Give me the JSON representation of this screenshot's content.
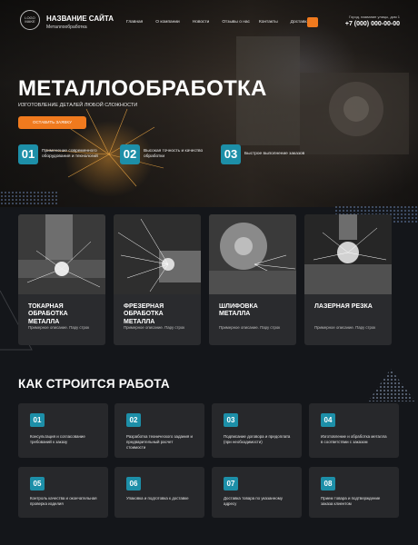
{
  "header": {
    "logo_text": "LOGO\nMAKE",
    "site_name": "НАЗВАНИЕ САЙТА",
    "site_tagline": "Металлообработка",
    "nav": [
      "Главная",
      "О компании",
      "Новости",
      "Отзывы о нас",
      "Контакты",
      "Доставка"
    ],
    "address": "Город, название улицы, дом 1",
    "phone": "+7 (000) 000-00-00"
  },
  "hero": {
    "title": "МЕТАЛЛООБРАБОТКА",
    "subtitle": "ИЗГОТОВЛЕНИЕ ДЕТАЛЕЙ ЛЮБОЙ СЛОЖНОСТИ",
    "cta_label": "ОСТАВИТЬ ЗАЯВКУ",
    "features": [
      {
        "num": "01",
        "text": "Применение современного\nоборудования и технологий"
      },
      {
        "num": "02",
        "text": "Высокая точность и качество\nобработки"
      },
      {
        "num": "03",
        "text": "Быстрое выполнение заказов"
      }
    ]
  },
  "services": [
    {
      "title": "ТОКАРНАЯ\nОБРАБОТКА\nМЕТАЛЛА",
      "desc": "Примерное описание. Пару строк"
    },
    {
      "title": "ФРЕЗЕРНАЯ\nОБРАБОТКА\nМЕТАЛЛА",
      "desc": "Примерное описание. Пару строк"
    },
    {
      "title": "ШЛИФОВКА\nМЕТАЛЛА",
      "desc": "Примерное описание. Пару строк"
    },
    {
      "title": "ЛАЗЕРНАЯ РЕЗКА",
      "desc": "Примерное описание. Пару строк"
    }
  ],
  "process": {
    "title": "КАК СТРОИТСЯ РАБОТА",
    "steps": [
      {
        "num": "01",
        "text": "Консультация и согласование\nтребований к заказу"
      },
      {
        "num": "02",
        "text": "Разработка технического задания и\nпредварительный расчет\nстоимости"
      },
      {
        "num": "03",
        "text": "Подписание договора и предоплата\n(при необходимости)"
      },
      {
        "num": "04",
        "text": "Изготовление и обработка металла\nв соответствии с заказом"
      },
      {
        "num": "05",
        "text": "Контроль качества и окончательная\nпроверка изделия"
      },
      {
        "num": "06",
        "text": "Упаковка и подготовка к доставке"
      },
      {
        "num": "07",
        "text": "Доставка товара по указанному\nадресу"
      },
      {
        "num": "08",
        "text": "Прием товара и подтверждение\nзаказа клиентом"
      }
    ]
  },
  "colors": {
    "accent_orange": "#f07a1e",
    "accent_teal": "#1d8fa8",
    "background": "#14161a",
    "card": "#2a2b2e"
  }
}
